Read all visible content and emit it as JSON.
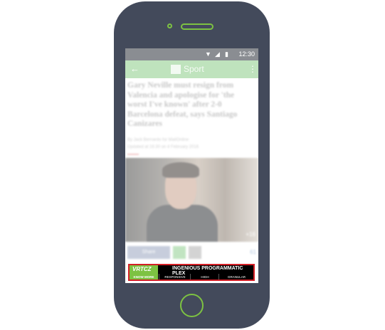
{
  "status": {
    "time": "12:30"
  },
  "appbar": {
    "back": "←",
    "brand": "Sport",
    "menu": "⋮"
  },
  "article": {
    "headline": "Gary Neville must resign from Valencia and apologise for 'the worst I've known' after 2-0 Barcelona defeat, says Santiago Canizares",
    "byline": "By Jack Bernardo for MailOnline",
    "updated": "Updated at 16:30 on 4 February 2016",
    "photo_count": "+16"
  },
  "share": {
    "facebook_label": "Share",
    "count": "61"
  },
  "ad": {
    "logo": "VRTCZ",
    "title": "INGENIOUS PROGRAMMATIC PLEX",
    "know_more": "KNOW MORE",
    "features": [
      "RESPONSIVE DESIGN",
      "HIGH ENGAGEMENT",
      "GRANULAR REPORTING"
    ]
  },
  "colors": {
    "phone": "#434a5b",
    "accent": "#7dc242",
    "ad_border": "#d41f26"
  }
}
